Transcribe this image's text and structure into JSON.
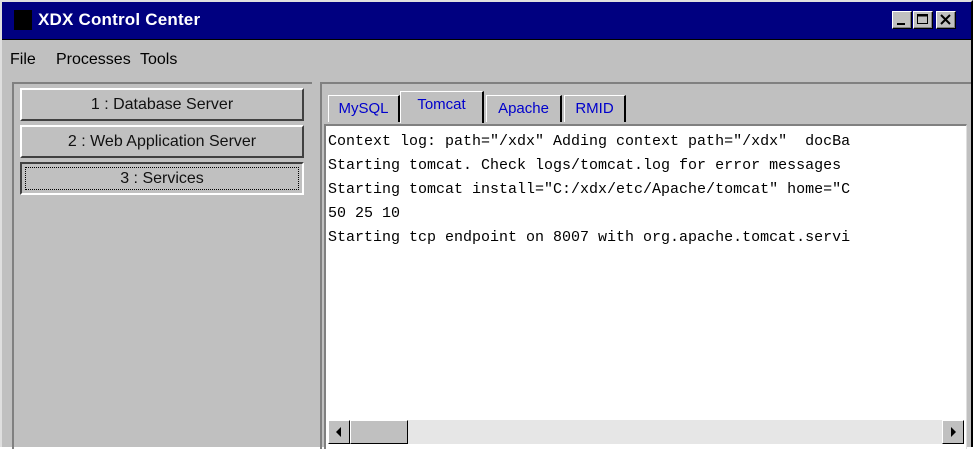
{
  "window": {
    "title": "XDX Control Center"
  },
  "menu": {
    "items": [
      "File",
      "Processes",
      "Tools"
    ]
  },
  "nav": {
    "buttons": [
      "1 : Database Server",
      "2 : Web Application Server",
      "3 : Services"
    ],
    "active_index": 2
  },
  "tabs": {
    "items": [
      "MySQL",
      "Tomcat",
      "Apache",
      "RMID"
    ],
    "active_index": 1
  },
  "log": {
    "lines": [
      "Context log: path=\"/xdx\" Adding context path=\"/xdx\"  docBa",
      "Starting tomcat. Check logs/tomcat.log for error messages",
      "Starting tomcat install=\"C:/xdx/etc/Apache/tomcat\" home=\"C",
      "50 25 10",
      "Starting tcp endpoint on 8007 with org.apache.tomcat.servi"
    ]
  },
  "colors": {
    "titlebar": "#000080",
    "face": "#c0c0c0",
    "tab_text": "#0000cc"
  },
  "icons": {
    "window_controls": [
      "minimize-icon",
      "maximize-icon",
      "close-icon"
    ],
    "scroll": [
      "scroll-left-arrow-icon",
      "scroll-right-arrow-icon"
    ]
  }
}
